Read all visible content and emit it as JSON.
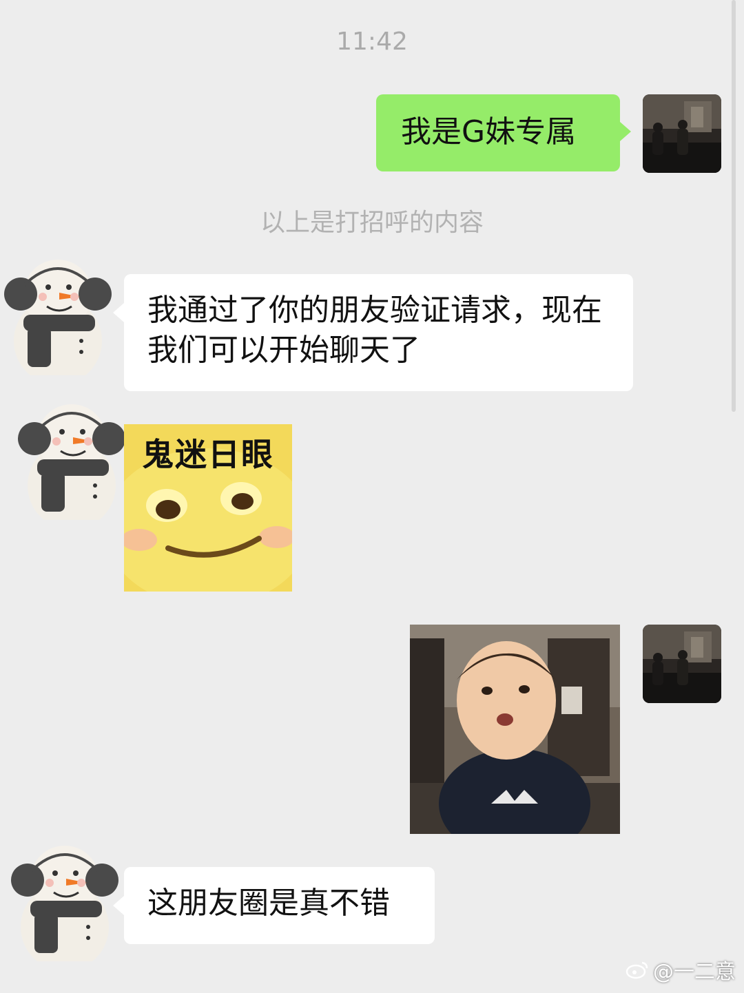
{
  "timestamp": "11:42",
  "messages": [
    {
      "from": "self",
      "type": "text",
      "text": "我是G妹专属"
    },
    {
      "type": "system",
      "text": "以上是打招呼的内容"
    },
    {
      "from": "contact",
      "type": "text",
      "text": "我通过了你的朋友验证请求，现在我们可以开始聊天了"
    },
    {
      "from": "contact",
      "type": "sticker",
      "caption": "鬼迷日眼"
    },
    {
      "from": "self",
      "type": "sticker",
      "caption": ""
    },
    {
      "from": "contact",
      "type": "text",
      "text": "这朋友圈是真不错"
    }
  ],
  "watermark": {
    "icon": "weibo-icon",
    "text": "@一二意"
  },
  "colors": {
    "background": "#ededed",
    "outgoing_bubble": "#95ec69",
    "incoming_bubble": "#ffffff"
  }
}
